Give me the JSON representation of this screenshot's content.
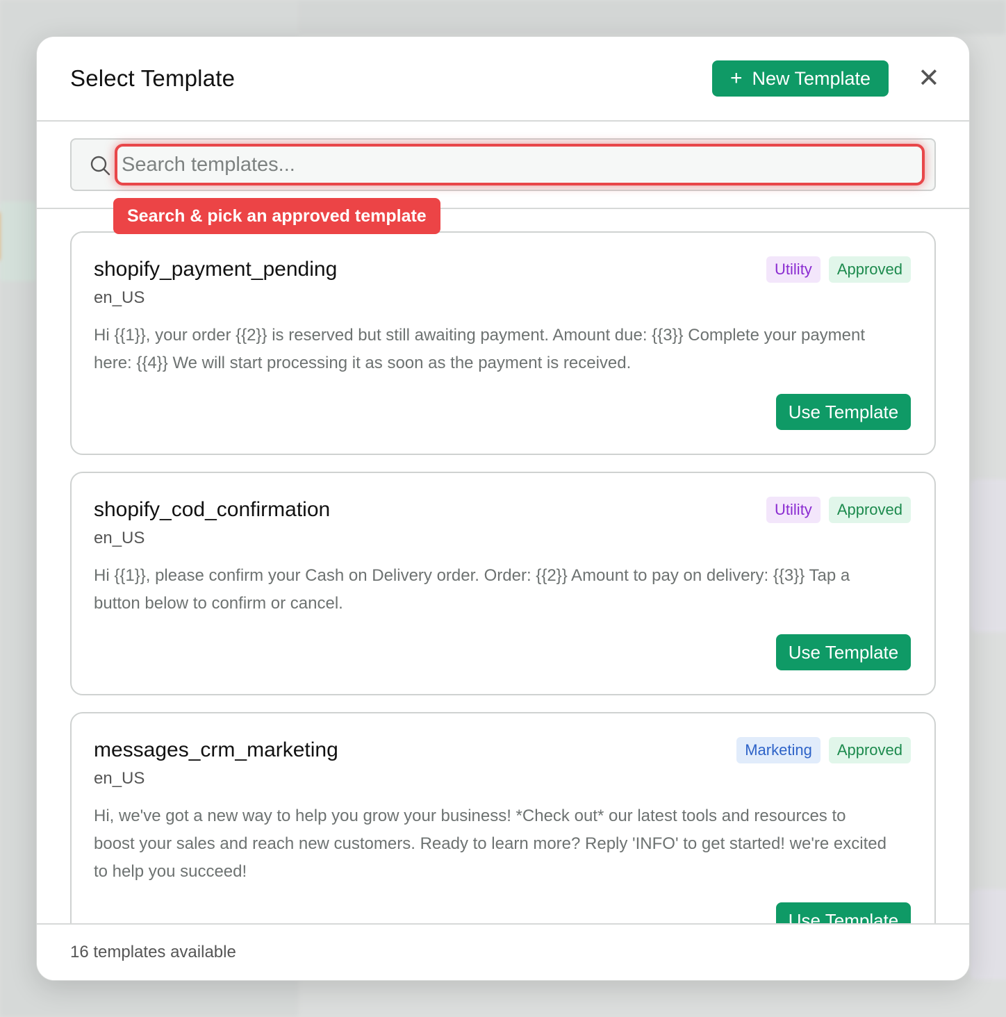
{
  "modal": {
    "title": "Select Template",
    "new_button_label": "New Template",
    "search_placeholder": "Search templates...",
    "tooltip": "Search & pick an approved template",
    "footer_count": "16 templates available"
  },
  "templates": [
    {
      "name": "shopify_payment_pending",
      "lang": "en_US",
      "category": "Utility",
      "status": "Approved",
      "body": "Hi {{1}}, your order {{2}} is reserved but still awaiting payment. Amount due: {{3}} Complete your payment here: {{4}} We will start processing it as soon as the payment is received.",
      "action": "Use Template"
    },
    {
      "name": "shopify_cod_confirmation",
      "lang": "en_US",
      "category": "Utility",
      "status": "Approved",
      "body": "Hi {{1}}, please confirm your Cash on Delivery order. Order: {{2}} Amount to pay on delivery: {{3}} Tap a button below to confirm or cancel.",
      "action": "Use Template"
    },
    {
      "name": "messages_crm_marketing",
      "lang": "en_US",
      "category": "Marketing",
      "status": "Approved",
      "body": "Hi, we've got a new way to help you grow your business! *Check out* our latest tools and resources to boost your sales and reach new customers. Ready to learn more? Reply 'INFO' to get started! we're excited to help you succeed!",
      "action": "Use Template"
    }
  ],
  "colors": {
    "primary": "#0f9a66",
    "highlight": "#ec4446",
    "utility_badge": "#8a2bd1",
    "marketing_badge": "#2e63c8",
    "approved_badge": "#1c8a4d"
  }
}
